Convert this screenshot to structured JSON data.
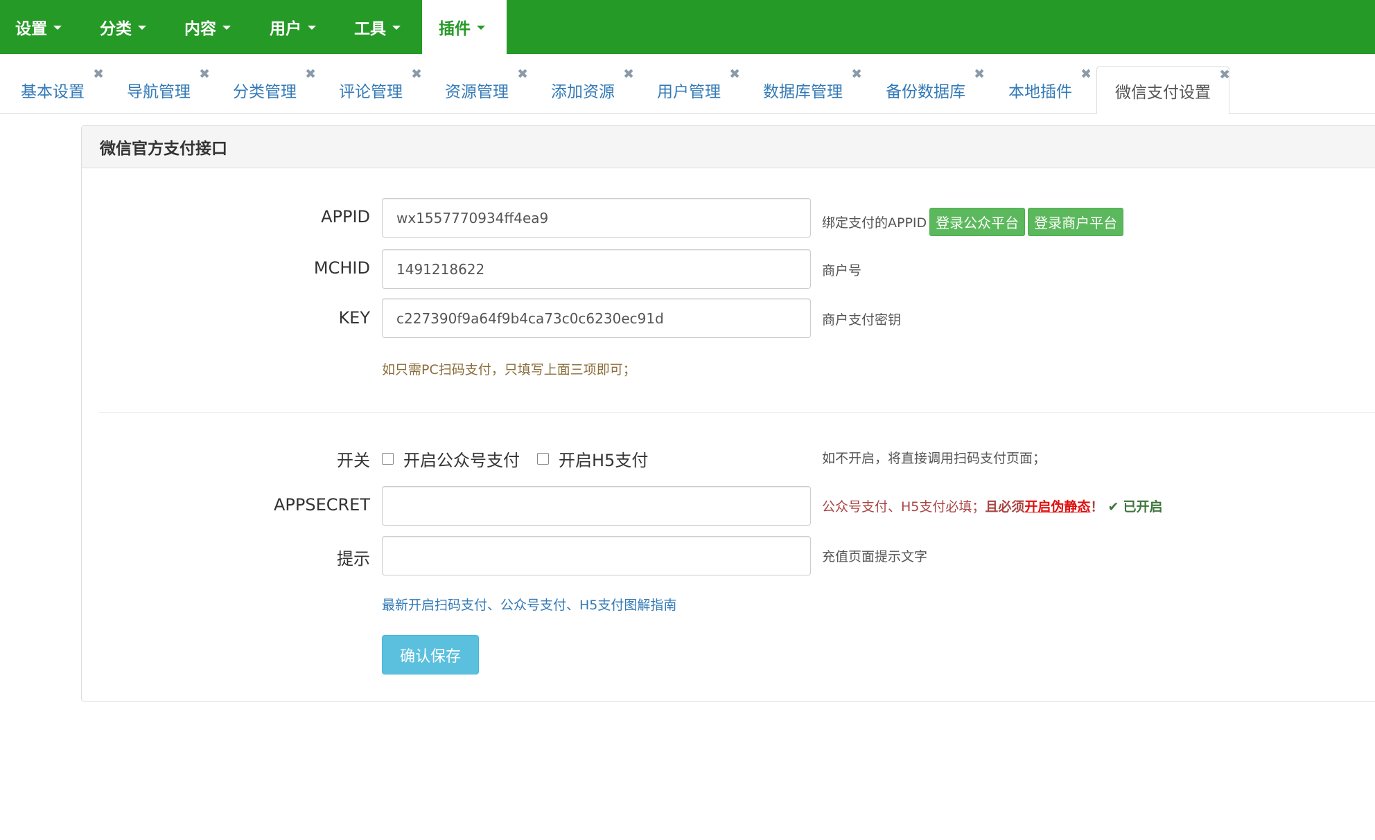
{
  "topnav": {
    "items": [
      {
        "label": "设置"
      },
      {
        "label": "分类"
      },
      {
        "label": "内容"
      },
      {
        "label": "用户"
      },
      {
        "label": "工具"
      },
      {
        "label": "插件"
      }
    ],
    "active_index": 5
  },
  "tabs": [
    {
      "label": "基本设置"
    },
    {
      "label": "导航管理"
    },
    {
      "label": "分类管理"
    },
    {
      "label": "评论管理"
    },
    {
      "label": "资源管理"
    },
    {
      "label": "添加资源"
    },
    {
      "label": "用户管理"
    },
    {
      "label": "数据库管理"
    },
    {
      "label": "备份数据库"
    },
    {
      "label": "本地插件"
    },
    {
      "label": "微信支付设置"
    }
  ],
  "tab_close_glyph": "✖",
  "panel": {
    "title": "微信官方支付接口"
  },
  "form": {
    "appid": {
      "label": "APPID",
      "value": "wx1557770934ff4ea9",
      "help": "绑定支付的APPID",
      "btn_mp": "登录公众平台",
      "btn_mch": "登录商户平台"
    },
    "mchid": {
      "label": "MCHID",
      "value": "1491218622",
      "help": "商户号"
    },
    "key": {
      "label": "KEY",
      "value": "c227390f9a64f9b4ca73c0c6230ec91d",
      "help": "商户支付密钥"
    },
    "pc_note": "如只需PC扫码支付，只填写上面三项即可；",
    "switch": {
      "label": "开关",
      "opt_mp": "开启公众号支付",
      "opt_h5": "开启H5支付",
      "help": "如不开启，将直接调用扫码支付页面；"
    },
    "appsecret": {
      "label": "APPSECRET",
      "value": "",
      "help_prefix": "公众号支付、H5支付必填；",
      "help_bold": "且必须",
      "help_link": "开启伪静态",
      "help_excl": "！",
      "status_check": "✔",
      "status_text": "已开启"
    },
    "tip": {
      "label": "提示",
      "value": "",
      "help": "充值页面提示文字"
    },
    "guide_link": "最新开启扫码支付、公众号支付、H5支付图解指南",
    "save": "确认保存"
  },
  "colors": {
    "nav_green": "#259a26",
    "link_blue": "#337ab7",
    "btn_green": "#5cb85c",
    "info_btn": "#5bc0de",
    "warning_text": "#a94442",
    "note_brown": "#8a6d3b",
    "success_green": "#3c763d",
    "link_red": "#e01010"
  }
}
